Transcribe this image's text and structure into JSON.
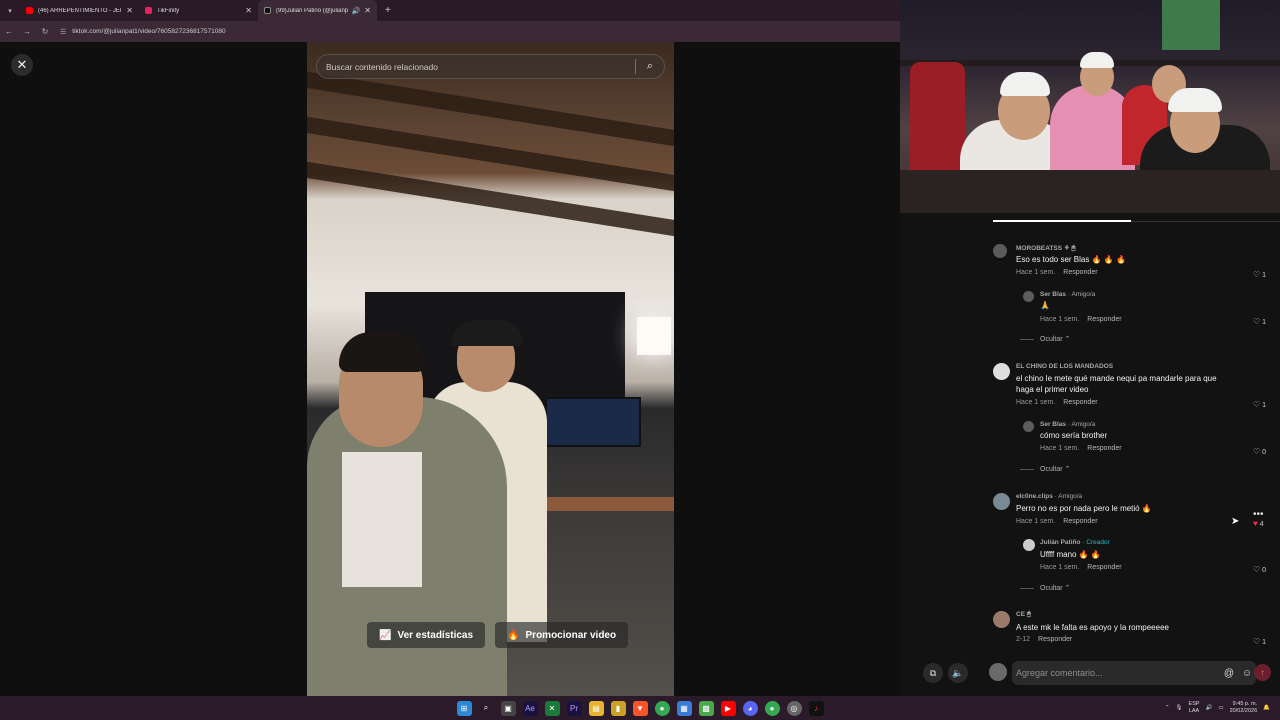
{
  "browser": {
    "tabs": [
      {
        "title": "(46) ARREPENTIMIENTO - JEIP",
        "color": "#ff0000"
      },
      {
        "title": "TikFinity",
        "color": "#e0245e"
      },
      {
        "title": "(99)Julián Patiño (@julianp",
        "color": "#111111",
        "active": true
      }
    ],
    "new_tab": "+",
    "url": "tiktok.com/@julianpat1/video/7605827236817571080"
  },
  "video": {
    "search_placeholder": "Buscar contenido relacionado",
    "stats_button": "Ver estadísticas",
    "promote_button": "Promocionar video"
  },
  "comments": [
    {
      "user": "MOROBEATSS",
      "badges": "⚘ 🖱",
      "text": "Eso es todo ser Blas 🔥 🔥 🔥",
      "time": "Hace 1 sem.",
      "reply": "Responder",
      "likes": "1"
    },
    {
      "user": "Ser Blas",
      "amigo": " · Amigo/a",
      "text": "🙏",
      "time": "Hace 1 sem.",
      "reply": "Responder",
      "likes": "1",
      "nested": true
    },
    {
      "user": "EL CHINO DE LOS MANDADOS",
      "text": "el chino le mete qué mande nequi pa mandarle para que",
      "text2": "haga el primer video",
      "time": "Hace 1 sem.",
      "reply": "Responder",
      "likes": "1"
    },
    {
      "user": "Ser Blas",
      "amigo": " · Amigo/a",
      "text": "cómo sería brother",
      "time": "Hace 1 sem.",
      "reply": "Responder",
      "likes": "0",
      "nested": true
    },
    {
      "user": "elc0ne.clips",
      "amigo": " · Amigo/a",
      "text": "Perro no es por nada pero le metió 🔥",
      "time": "Hace 1 sem.",
      "reply": "Responder",
      "likes": "4",
      "liked": true
    },
    {
      "user": "Julián Patiño",
      "creator": " · Creador",
      "text": "Uffff mano 🔥 🔥",
      "time": "Hace 1 sem.",
      "reply": "Responder",
      "likes": "0",
      "nested": true
    },
    {
      "user": "CE",
      "badges": "🖱",
      "text": "A este mk le falta es apoyo y la rompeeeee",
      "time": "2-12",
      "reply": "Responder",
      "likes": "1"
    }
  ],
  "hide_label": "Ocultar ⌃",
  "comment_input": {
    "placeholder": "Agregar comentario...",
    "mention": "@",
    "emoji": "☺"
  },
  "tray": {
    "lang1": "ESP",
    "lang2": "LAA",
    "time": "9:45 p. m.",
    "date": "20/02/2026"
  }
}
